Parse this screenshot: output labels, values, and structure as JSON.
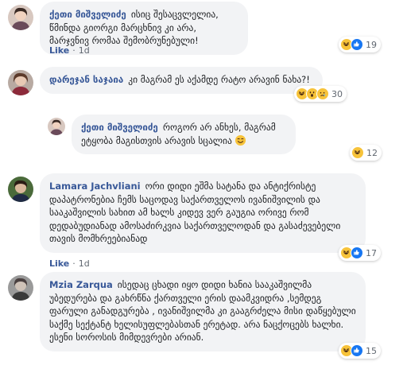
{
  "comments": [
    {
      "author": "ქეთი მიშველიძე",
      "text": "ისიც შესაცვლელია, წმინდა გიორგი მარცხნივ კი არა, მარჯვნივ რომაა შემობრუნებული!",
      "reactions": [
        "haha",
        "like"
      ],
      "count": "19",
      "like_label": "Like",
      "time": "1d"
    },
    {
      "author": "დარეჯან საჯაია",
      "text": "კი მაგრამ ეს აქამდე რატო არავინ ნახა?!",
      "reactions": [
        "haha",
        "wow",
        "sad"
      ],
      "count": "30",
      "like_label": "",
      "time": ""
    },
    {
      "author": "ქეთი მიშველიძე",
      "text": "როგორ არ ანხეს, მაგრამ ეტყობა მაგისთვის არავის სცალია",
      "reactions": [
        "haha"
      ],
      "count": "12",
      "like_label": "",
      "time": ""
    },
    {
      "author": "Lamara Jachvliani",
      "text": "ორი დიდი ეშმა სატანა და ანტიქრისტე დაპატრონებია ჩემს საცოდავ საქართველოს ივანიშვილის და სააკაშვილის სახით ამ ხალს კიდევ ვერ გაუგია ორივე რომ დედაბუდიანად ამოსაძირკვია საქართველოდან და გასაძევებელი თავის მომხრეებიანად",
      "reactions": [
        "haha",
        "like"
      ],
      "count": "17",
      "like_label": "Like",
      "time": "1d"
    },
    {
      "author": "Mzia Zarqua",
      "text": "ისედაც ცხადი იყო დიდი ხანია სააკაშვილმა უბედურება და გახრწნა ქართველი ერის დაამკვიდრა ,სემდეგ ფარული განადგურება , ივანიშვილმა კი გააგრძელა მისი დაწყებული საქმე სექტანტ ხელისუფლებასთან ერეტად. არა ნაცქოცებს ხალხი. ესენი სოროსის მიმდევრები არიან.",
      "reactions": [
        "haha",
        "like"
      ],
      "count": "15",
      "like_label": "",
      "time": ""
    }
  ]
}
